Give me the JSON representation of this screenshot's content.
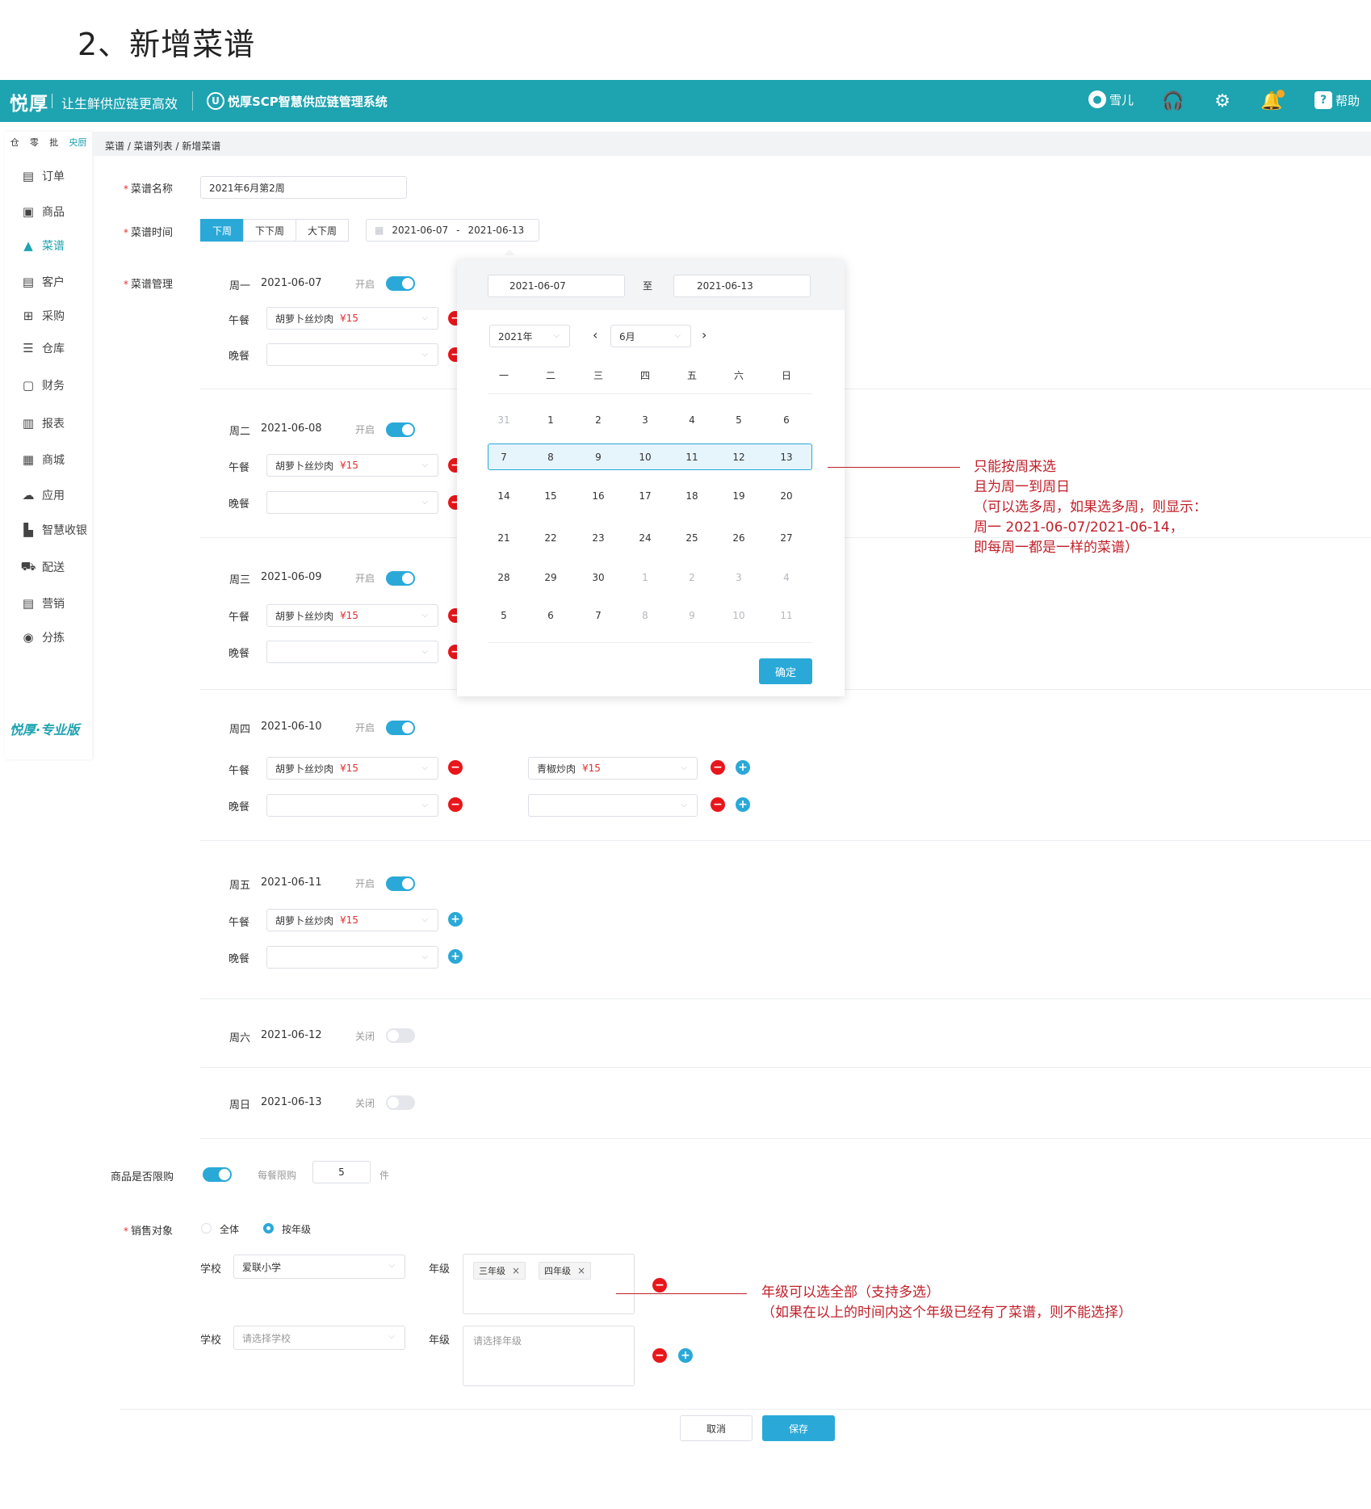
{
  "doc_title": "2、新增菜谱",
  "topbar": {
    "brand": "悦厚",
    "slogan": "让生鲜供应链更高效",
    "sys_logo": "U",
    "system_name": "悦厚SCP智慧供应链管理系统",
    "user_name": "雪儿",
    "help_label": "帮助",
    "bg_color": "#1ea3b0"
  },
  "sidebar": {
    "tabs": [
      "仓",
      "零",
      "批",
      "央厨"
    ],
    "items": [
      "订单",
      "商品",
      "菜谱",
      "客户",
      "采购",
      "仓库",
      "财务",
      "报表",
      "商城",
      "应用",
      "智慧收银",
      "配送",
      "营销",
      "分拣"
    ],
    "active_item": "菜谱",
    "pro_label": "悦厚·专业版"
  },
  "breadcrumb": "菜谱  /  菜谱列表  /  新增菜谱",
  "form": {
    "name_label": "菜谱名称",
    "name_value": "2021年6月第2周",
    "time_label": "菜谱时间",
    "time_buttons": [
      "下周",
      "下下周",
      "大下周"
    ],
    "date_start": "2021-06-07",
    "date_sep": "-",
    "date_end": "2021-06-13",
    "manage_label": "菜谱管理",
    "lunch": "午餐",
    "dinner": "晚餐",
    "on_text": "开启",
    "off_text": "关闭",
    "dish_a": "胡萝卜丝炒肉",
    "dish_b": "青椒炒肉",
    "price": "¥15"
  },
  "days": [
    {
      "name": "周一",
      "date": "2021-06-07",
      "status": "开启"
    },
    {
      "name": "周二",
      "date": "2021-06-08",
      "status": "开启"
    },
    {
      "name": "周三",
      "date": "2021-06-09",
      "status": "开启"
    },
    {
      "name": "周四",
      "date": "2021-06-10",
      "status": "开启"
    },
    {
      "name": "周五",
      "date": "2021-06-11",
      "status": "开启"
    },
    {
      "name": "周六",
      "date": "2021-06-12",
      "status": "关闭"
    },
    {
      "name": "周日",
      "date": "2021-06-13",
      "status": "关闭"
    }
  ],
  "calendar": {
    "from": "2021-06-07",
    "to_label": "至",
    "to": "2021-06-13",
    "year": "2021年",
    "month": "6月",
    "weekdays": [
      "一",
      "二",
      "三",
      "四",
      "五",
      "六",
      "日"
    ],
    "weeks": [
      [
        "31",
        "1",
        "2",
        "3",
        "4",
        "5",
        "6"
      ],
      [
        "7",
        "8",
        "9",
        "10",
        "11",
        "12",
        "13"
      ],
      [
        "14",
        "15",
        "16",
        "17",
        "18",
        "19",
        "20"
      ],
      [
        "21",
        "22",
        "23",
        "24",
        "25",
        "26",
        "27"
      ],
      [
        "28",
        "29",
        "30",
        "1",
        "2",
        "3",
        "4"
      ],
      [
        "5",
        "6",
        "7",
        "8",
        "9",
        "10",
        "11"
      ]
    ],
    "confirm": "确定"
  },
  "annotation_1": [
    "只能按周来选",
    "且为周一到周日",
    "（可以选多周，如果选多周，则显示：",
    "周一 2021-06-07/2021-06-14，",
    "即每周一都是一样的菜谱）"
  ],
  "annotation_2": [
    "年级可以选全部（支持多选）",
    "（如果在以上的时间内这个年级已经有了菜谱，则不能选择）"
  ],
  "limit": {
    "label": "商品是否限购",
    "per_meal": "每餐限购",
    "qty": "5",
    "unit": "件"
  },
  "target": {
    "label": "销售对象",
    "opt_all": "全体",
    "opt_grade": "按年级",
    "school_label": "学校",
    "grade_label": "年级",
    "school_1": "爱联小学",
    "grade_tags": [
      "三年级",
      "四年级"
    ],
    "school_placeholder": "请选择学校",
    "grade_placeholder": "请选择年级"
  },
  "footer": {
    "cancel": "取消",
    "save": "保存"
  }
}
